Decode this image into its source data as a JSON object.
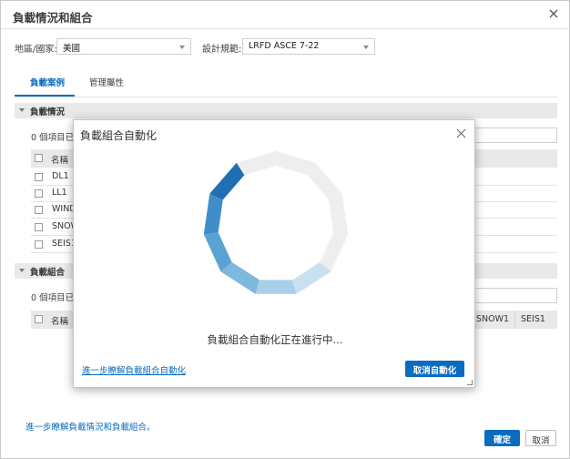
{
  "dialog": {
    "title": "負載情況和組合",
    "region_label": "地區/國家:",
    "region_value": "美國",
    "code_label": "設計規範:",
    "code_value": "LRFD ASCE 7-22",
    "tabs": [
      "負載案例",
      "管理屬性"
    ],
    "active_tab": "負載案例"
  },
  "load_cases": {
    "header": "負載情況",
    "selected_text": "0 個項目已選",
    "column_name": "名稱",
    "rows": [
      "DL1",
      "LL1",
      "WIND",
      "SNOW",
      "SEIS1"
    ]
  },
  "load_combinations": {
    "header": "負載組合",
    "selected_text": "0 個項目已選",
    "column_name": "名稱",
    "extra_columns": [
      "SNOW1",
      "SEIS1"
    ]
  },
  "footer": {
    "help_link": "進一步瞭解負載情況和負載組合。",
    "ok_label": "確定",
    "cancel_label": "取消"
  },
  "modal": {
    "title": "負載組合自動化",
    "progress_text": "負載組合自動化正在進行中...",
    "help_link": "進一步瞭解負載組合自動化",
    "cancel_label": "取消自動化"
  },
  "colors": {
    "accent": "#0a6bbf",
    "spinner_track": "#eeeeee",
    "spinner_dark": "#1f6fb5",
    "spinner_light": "#c3dff0"
  }
}
